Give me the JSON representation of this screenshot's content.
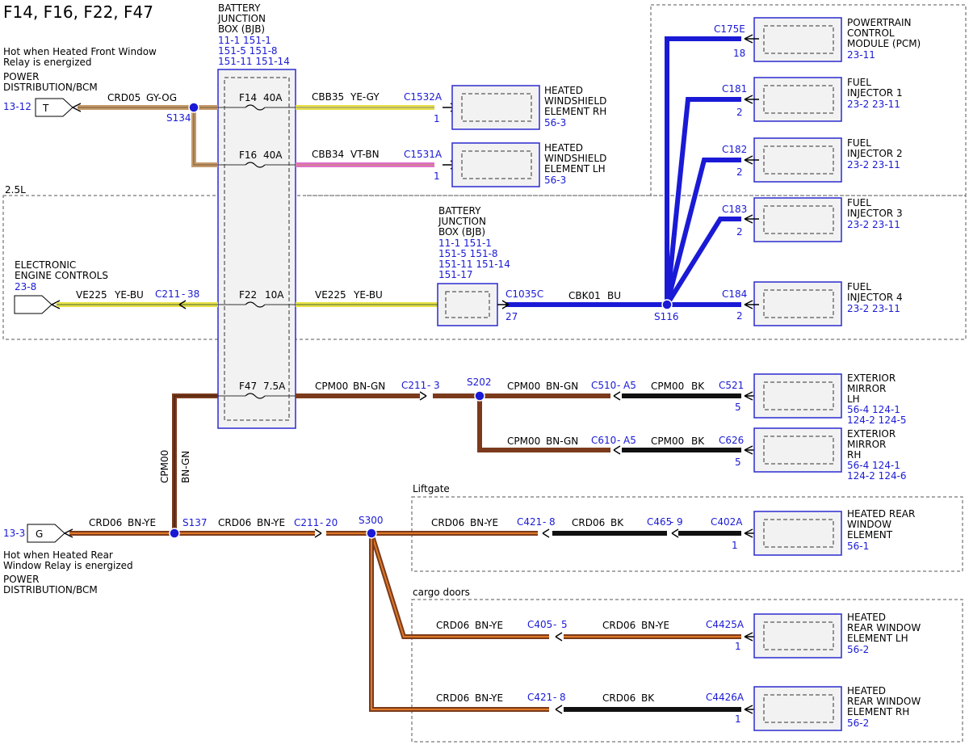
{
  "page_title": "F14, F16, F22, F47",
  "colors": {
    "blue": "#1a1ad6",
    "brown": "#7b3a1c",
    "orange": "#e07a26",
    "grey_orange": "#c49a6c",
    "yellow": "#f0e600",
    "pink": "#e060c0",
    "black": "#111111"
  },
  "regions": {
    "engine_2_5l": "2.5L",
    "liftgate": "Liftgate",
    "cargo_doors": "cargo doors"
  },
  "bjb_top": {
    "label1": "BATTERY",
    "label2": "JUNCTION",
    "label3": "BOX (BJB)",
    "ref1": "11-1   151-1",
    "ref2": "151-5   151-8",
    "ref3": "151-11  151-14"
  },
  "bjb_mid": {
    "label1": "BATTERY",
    "label2": "JUNCTION",
    "label3": "BOX (BJB)",
    "ref1": "11-1   151-1",
    "ref2": "151-5   151-8",
    "ref3": "151-11  151-14",
    "ref4": "151-17",
    "connector": "C1035C",
    "pin": "27"
  },
  "source_t": {
    "note1": "Hot when Heated Front Window",
    "note2": "Relay is energized",
    "name1": "POWER",
    "name2": "DISTRIBUTION/BCM",
    "ref": "13-12",
    "letter": "T",
    "wire": "CRD05",
    "color": "GY-OG",
    "splice": "S134"
  },
  "fuses": {
    "f14": {
      "name": "F14",
      "rating": "40A",
      "wire": "CBB35",
      "color": "YE-GY",
      "conn": "C1532A",
      "pin": "1",
      "load1": "HEATED",
      "load2": "WINDSHIELD",
      "load3": "ELEMENT RH",
      "ref": "56-3"
    },
    "f16": {
      "name": "F16",
      "rating": "40A",
      "wire": "CBB34",
      "color": "VT-BN",
      "conn": "C1531A",
      "pin": "1",
      "load1": "HEATED",
      "load2": "WINDSHIELD",
      "load3": "ELEMENT LH",
      "ref": "56-3"
    },
    "f22": {
      "name": "F22",
      "rating": "10A"
    },
    "f47": {
      "name": "F47",
      "rating": "7.5A"
    }
  },
  "eec": {
    "name1": "ELECTRONIC",
    "name2": "ENGINE CONTROLS",
    "ref": "23-8",
    "wire_l": "VE225",
    "color_l": "YE-BU",
    "conn": "C211",
    "pin": "38",
    "wire_r": "VE225",
    "color_r": "YE-BU"
  },
  "cbk01": {
    "wire": "CBK01",
    "color": "BU",
    "splice": "S116"
  },
  "pcm": {
    "conn": "C175E",
    "pin": "18",
    "name1": "POWERTRAIN",
    "name2": "CONTROL",
    "name3": "MODULE (PCM)",
    "ref": "23-11"
  },
  "injectors": [
    {
      "conn": "C181",
      "pin": "2",
      "name1": "FUEL",
      "name2": "INJECTOR 1",
      "ref": "23-2   23-11"
    },
    {
      "conn": "C182",
      "pin": "2",
      "name1": "FUEL",
      "name2": "INJECTOR 2",
      "ref": "23-2   23-11"
    },
    {
      "conn": "C183",
      "pin": "2",
      "name1": "FUEL",
      "name2": "INJECTOR 3",
      "ref": "23-2   23-11"
    },
    {
      "conn": "C184",
      "pin": "2",
      "name1": "FUEL",
      "name2": "INJECTOR 4",
      "ref": "23-2   23-11"
    }
  ],
  "mirrors": {
    "wire": "CPM00",
    "color": "BN-GN",
    "conn1": "C211",
    "pin1": "3",
    "splice": "S202",
    "vert_wire": "CPM00",
    "vert_color": "BN-GN",
    "lh": {
      "wire": "CPM00",
      "color": "BN-GN",
      "conn": "C510",
      "pin": "A5",
      "wire2": "CPM00",
      "color2": "BK",
      "conn2": "C521",
      "pin2": "5",
      "name1": "EXTERIOR",
      "name2": "MIRROR",
      "name3": "LH",
      "ref1": "56-4    124-1",
      "ref2": "124-2   124-5"
    },
    "rh": {
      "wire": "CPM00",
      "color": "BN-GN",
      "conn": "C610",
      "pin": "A5",
      "wire2": "CPM00",
      "color2": "BK",
      "conn2": "C626",
      "pin2": "5",
      "name1": "EXTERIOR",
      "name2": "MIRROR",
      "name3": "RH",
      "ref1": "56-4    124-1",
      "ref2": "124-2   124-6"
    }
  },
  "source_g": {
    "ref": "13-3",
    "letter": "G",
    "note1": "Hot when Heated Rear",
    "note2": "Window Relay is energized",
    "name1": "POWER",
    "name2": "DISTRIBUTION/BCM",
    "wire": "CRD06",
    "color": "BN-YE",
    "splice1": "S137",
    "wire2": "CRD06",
    "color2": "BN-YE",
    "conn": "C211",
    "pin": "20",
    "splice2": "S300"
  },
  "rear_window": {
    "wire": "CRD06",
    "color": "BN-YE",
    "conn": "C421",
    "pin": "8",
    "wire2": "CRD06",
    "color2": "BK",
    "conn2": "C465",
    "pin2": "9",
    "conn3": "C402A",
    "pin3": "1",
    "name1": "HEATED REAR",
    "name2": "WINDOW",
    "name3": "ELEMENT",
    "ref": "56-1"
  },
  "cargo_lh": {
    "wire": "CRD06",
    "color": "BN-YE",
    "conn": "C405",
    "pin": "5",
    "wire2": "CRD06",
    "color2": "BN-YE",
    "conn2": "C4425A",
    "pin2": "1",
    "name1": "HEATED",
    "name2": "REAR WINDOW",
    "name3": "ELEMENT LH",
    "ref": "56-2"
  },
  "cargo_rh": {
    "wire": "CRD06",
    "color": "BN-YE",
    "conn": "C421",
    "pin": "8",
    "wire2": "CRD06",
    "color2": "BK",
    "conn2": "C4426A",
    "pin2": "1",
    "name1": "HEATED",
    "name2": "REAR WINDOW",
    "name3": "ELEMENT RH",
    "ref": "56-2"
  },
  "sep": {
    "dash": "-"
  }
}
